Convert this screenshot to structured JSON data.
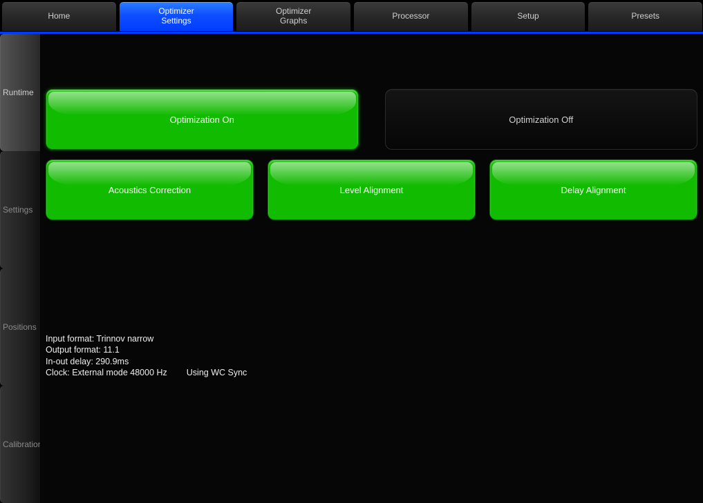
{
  "topnav": {
    "tabs": [
      {
        "label": "Home"
      },
      {
        "label": "Optimizer\nSettings",
        "active": true
      },
      {
        "label": "Optimizer\nGraphs"
      },
      {
        "label": "Processor"
      },
      {
        "label": "Setup"
      },
      {
        "label": "Presets"
      }
    ]
  },
  "sidebar": {
    "tabs": [
      {
        "label": "Runtime",
        "active": true
      },
      {
        "label": "Settings"
      },
      {
        "label": "Positions"
      },
      {
        "label": "Calibration"
      }
    ]
  },
  "main": {
    "opt_on_label": "Optimization On",
    "opt_off_label": "Optimization Off",
    "acoustics_label": "Acoustics Correction",
    "level_label": "Level Alignment",
    "delay_label": "Delay Alignment"
  },
  "status": {
    "input_format": "Input format: Trinnov narrow",
    "output_format": "Output format: 11.1",
    "inout_delay": "In-out delay: 290.9ms",
    "clock_mode": "Clock: External mode 48000 Hz",
    "clock_sync": "Using WC Sync"
  }
}
